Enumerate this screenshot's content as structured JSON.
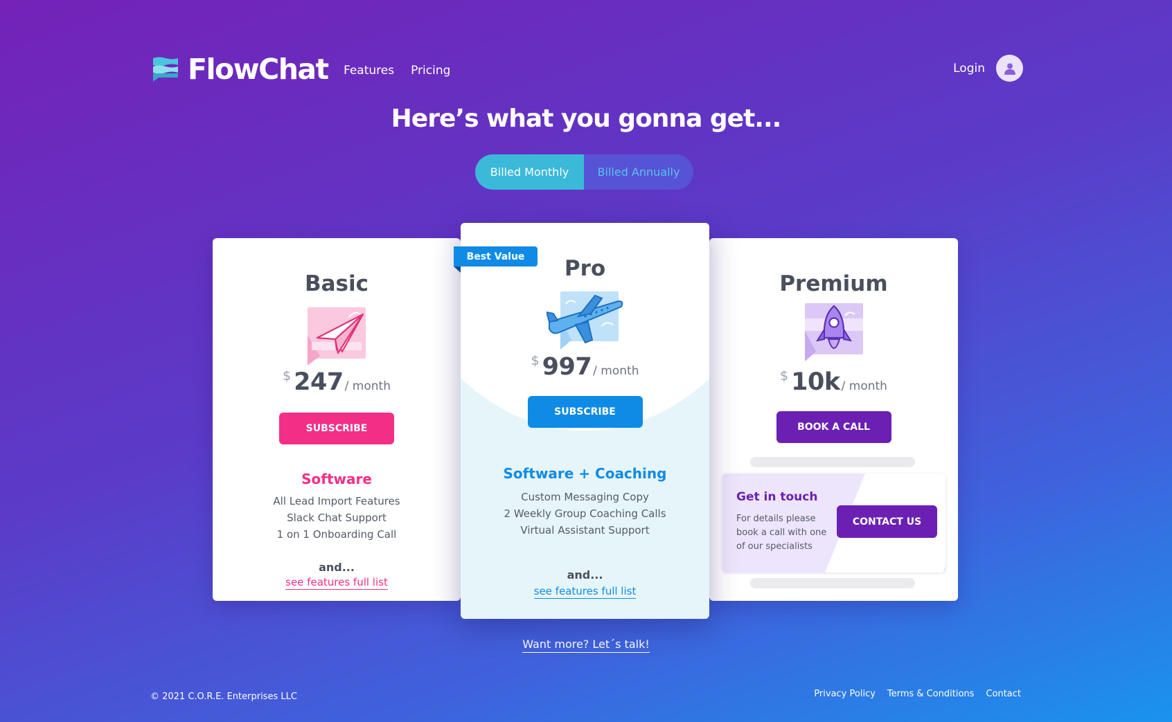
{
  "brand": {
    "name": "FlowChat"
  },
  "nav": {
    "features": "Features",
    "pricing": "Pricing",
    "login": "Login"
  },
  "headline": "Here’s what you gonna get...",
  "billing": {
    "monthly": "Billed Monthly",
    "annually": "Billed Annually",
    "selected": "monthly"
  },
  "plans": {
    "basic": {
      "name": "Basic",
      "currency": "$",
      "amount": "247",
      "period": "/ month",
      "button": "SUBSCRIBE",
      "tier": "Software",
      "features": [
        "All Lead Import Features",
        "Slack Chat Support",
        "1 on 1 Onboarding Call"
      ],
      "and": "and...",
      "link": "see features full list"
    },
    "pro": {
      "badge": "Best Value",
      "name": "Pro",
      "currency": "$",
      "amount": "997",
      "period": "/ month",
      "button": "SUBSCRIBE",
      "tier": "Software + Coaching",
      "features": [
        "Custom Messaging Copy",
        "2 Weekly Group Coaching Calls",
        "Virtual Assistant Support"
      ],
      "and": "and...",
      "link": "see features full list"
    },
    "premium": {
      "name": "Premium",
      "currency": "$",
      "amount": "10k",
      "period": "/ month",
      "button": "BOOK A CALL",
      "contact": {
        "title": "Get in touch",
        "text": "For details please book a call with one of our specialists",
        "button": "CONTACT US"
      }
    }
  },
  "want_more": "Want more? Let´s talk!",
  "footer": {
    "copyright": "© 2021 C.O.R.E. Enterprises LLC",
    "links": [
      "Privacy Policy",
      "Terms & Conditions",
      "Contact"
    ]
  },
  "colors": {
    "pink": "#f32e86",
    "blue": "#0f8be6",
    "purple": "#6b20b3",
    "teal": "#3ab9d9"
  }
}
